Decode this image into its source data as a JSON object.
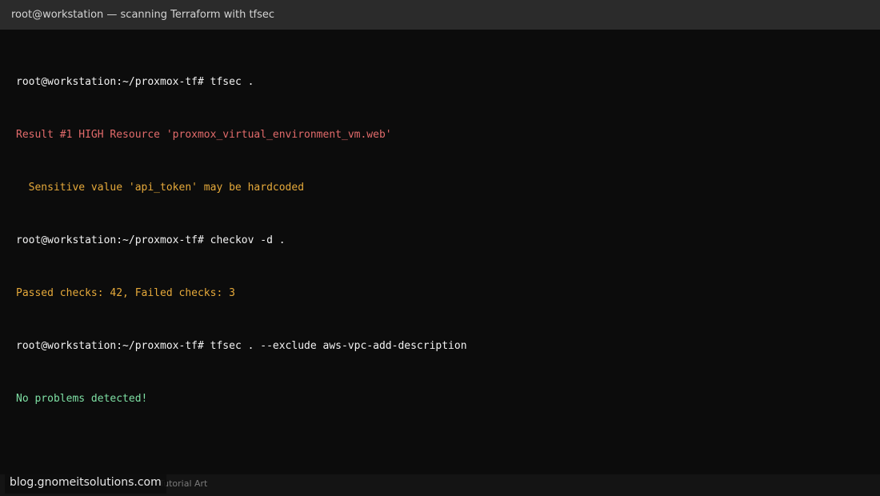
{
  "window": {
    "title": "root@workstation — scanning Terraform with tfsec"
  },
  "terminal": {
    "lines": [
      {
        "prompt": "root@workstation:~/proxmox-tf#",
        "command": "tfsec ."
      },
      {
        "text": "Result #1 HIGH Resource 'proxmox_virtual_environment_vm.web'"
      },
      {
        "text": "  Sensitive value 'api_token' may be hardcoded"
      },
      {
        "prompt": "root@workstation:~/proxmox-tf#",
        "command": "checkov -d ."
      },
      {
        "text": "Passed checks: 42, Failed checks: 3"
      },
      {
        "prompt": "root@workstation:~/proxmox-tf#",
        "command": "tfsec . --exclude aws-vpc-add-description"
      },
      {
        "text": "No problems detected!"
      }
    ]
  },
  "footer": {
    "caption": "Tutorial Art"
  },
  "watermark": {
    "text": "blog.gnomeitsolutions.com"
  },
  "colors": {
    "background": "#0c0c0c",
    "titlebar": "#2b2b2b",
    "error": "#e26b6b",
    "warning": "#e5a93a",
    "success": "#7ee0a4"
  }
}
